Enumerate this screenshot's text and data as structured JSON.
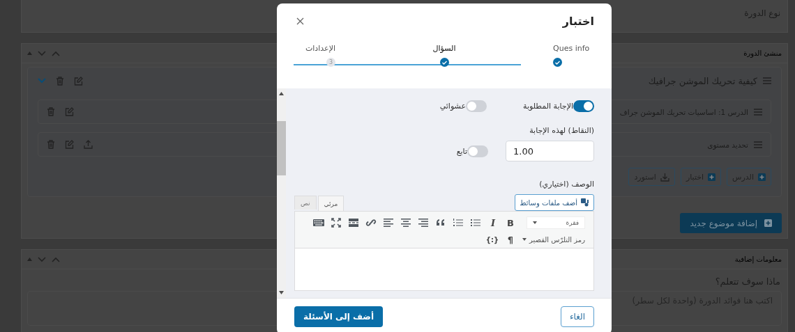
{
  "page": {
    "course_type_panel": {
      "title": "نوع الدورة"
    },
    "builder_panel": {
      "title": "منشئ الدورة",
      "topic": {
        "title": "كيفية تحريك الموشن جرافيك",
        "expanded": true,
        "items": [
          {
            "kind": "lesson",
            "title": "الدرس 1: اساسيات تحريك الموشن جراف"
          },
          {
            "kind": "quiz",
            "title": "تحديد مستوى"
          }
        ],
        "actions": [
          {
            "kind": "add",
            "label": "الدرس"
          },
          {
            "kind": "add",
            "label": "اختبار"
          },
          {
            "kind": "import",
            "label": "استورد"
          }
        ]
      },
      "add_topic_button": "إضافة موضوع جديد"
    },
    "extra_panel": {
      "title": "معلومات إضافية",
      "field_label": "ماذا سوف تتعلم؟",
      "placeholder": "اكتب هنا فوائد الدورة (واحدة لكل سطر)"
    }
  },
  "modal": {
    "title": "اختبار",
    "steps": [
      {
        "label": "Ques info",
        "done": true,
        "selected": false
      },
      {
        "label": "السؤال",
        "done": true,
        "selected": true
      },
      {
        "label": "الإعدادات",
        "done": false,
        "number": "3",
        "selected": false
      }
    ],
    "toggles": [
      {
        "label": "الإجابة المطلوبة",
        "on": true
      },
      {
        "label": "عشوائي",
        "on": false
      }
    ],
    "points": {
      "label": "(النقاط) لهذه الإجابة",
      "value": "1.00",
      "toggle": {
        "label": "تابع",
        "on": false
      }
    },
    "description": {
      "label": "الوصف (اختياري)",
      "media_button": "أضف ملفات وسائط",
      "tabs": [
        {
          "label": "مرئي",
          "selected": true
        },
        {
          "label": "نص",
          "selected": false
        }
      ],
      "format": "فقرة",
      "toolbar": [
        {
          "kind": "bold",
          "glyph": "B"
        },
        {
          "kind": "italic",
          "glyph": "I"
        },
        {
          "kind": "bullets"
        },
        {
          "kind": "numbers"
        },
        {
          "kind": "quote"
        },
        {
          "kind": "align-right"
        },
        {
          "kind": "align-center"
        },
        {
          "kind": "align-left"
        },
        {
          "kind": "link"
        },
        {
          "kind": "more"
        },
        {
          "kind": "fullscreen"
        },
        {
          "kind": "keyboard"
        }
      ],
      "shortcode": "رمز التلرّس القصير",
      "toolbar_2": [
        {
          "kind": "direction",
          "glyph": "¶"
        },
        {
          "kind": "code",
          "glyph": "{:}"
        }
      ]
    },
    "buttons": {
      "cancel": "الغاء",
      "submit": "أضف إلى الأسئلة"
    }
  }
}
